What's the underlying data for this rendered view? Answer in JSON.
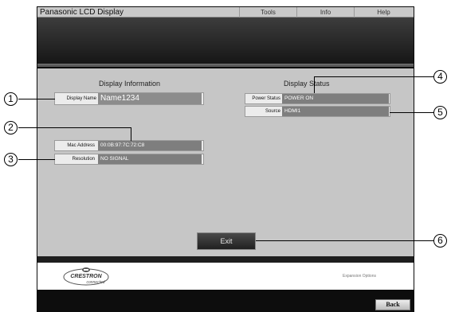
{
  "window": {
    "title": "Panasonic LCD Display",
    "menu": [
      "Tools",
      "Info",
      "Help"
    ]
  },
  "display_information": {
    "title": "Display Information",
    "display_name_label": "Display Name",
    "display_name_value": "Name1234",
    "mac_address_label": "Mac Address",
    "mac_address_value": "00:0B:97:7C:72:C8",
    "resolution_label": "Resolution",
    "resolution_value": "NO SIGNAL"
  },
  "display_status": {
    "title": "Display Status",
    "power_status_label": "Power Status",
    "power_status_value": "POWER ON",
    "source_label": "Source",
    "source_value": "HDMI1"
  },
  "buttons": {
    "exit": "Exit",
    "back": "Back"
  },
  "footer": {
    "logo_brand": "CRESTRON",
    "logo_tagline": "connected",
    "expansion_options": "Expansion Options"
  },
  "callouts": [
    "1",
    "2",
    "3",
    "4",
    "5",
    "6"
  ],
  "colors": {
    "panel": "#c6c6c6",
    "value_field": "#7e7e7e",
    "frame": "#0a0a0a"
  }
}
